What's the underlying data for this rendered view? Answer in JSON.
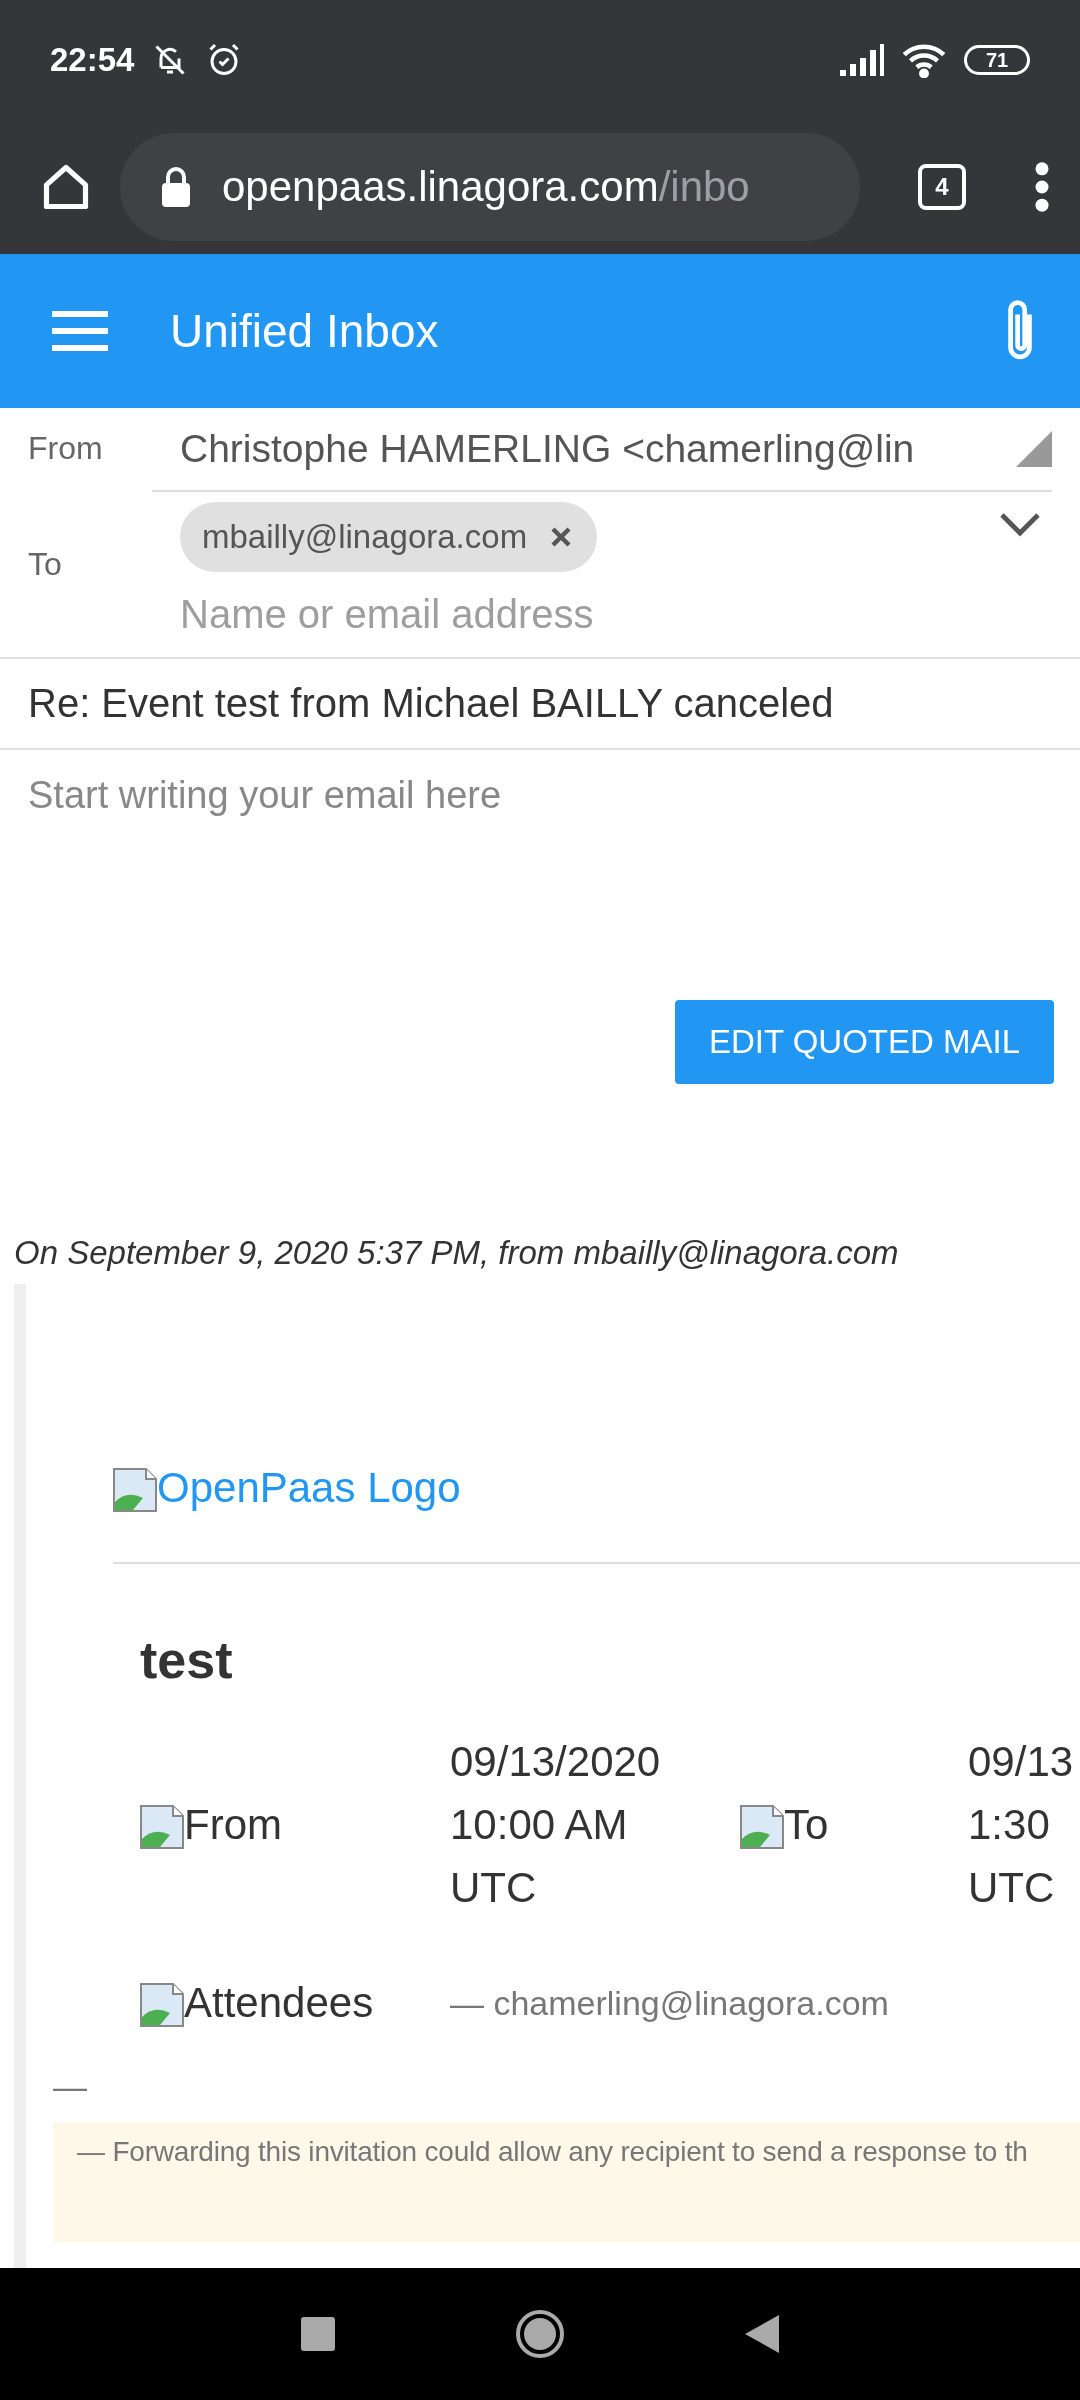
{
  "status_bar": {
    "time": "22:54",
    "battery": "71"
  },
  "browser": {
    "url_host": "openpaas.linagora.com",
    "url_path": "/inbo",
    "tab_count": "4"
  },
  "app_bar": {
    "title": "Unified Inbox"
  },
  "compose": {
    "from_label": "From",
    "from_value": "Christophe HAMERLING <chamerling@lin",
    "to_label": "To",
    "recipients": [
      {
        "address": "mbailly@linagora.com"
      }
    ],
    "to_placeholder": "Name or email address",
    "subject": "Re: Event test from Michael BAILLY canceled",
    "body_placeholder": "Start writing your email here",
    "edit_button": "EDIT QUOTED MAIL"
  },
  "quote": {
    "header": "On September 9, 2020 5:37 PM, from mbailly@linagora.com",
    "logo_alt": "OpenPaas Logo",
    "title": "test",
    "from_label": "From",
    "from_value": [
      "09/13/2020",
      "10:00 AM",
      "UTC"
    ],
    "to_label": "To",
    "to_value": [
      "09/13",
      "1:30",
      "UTC"
    ],
    "attendees_label": "Attendees",
    "attendees_value": "— chamerling@linagora.com",
    "separator": "—",
    "notice": "— Forwarding this invitation could allow any recipient to send a response to th"
  }
}
